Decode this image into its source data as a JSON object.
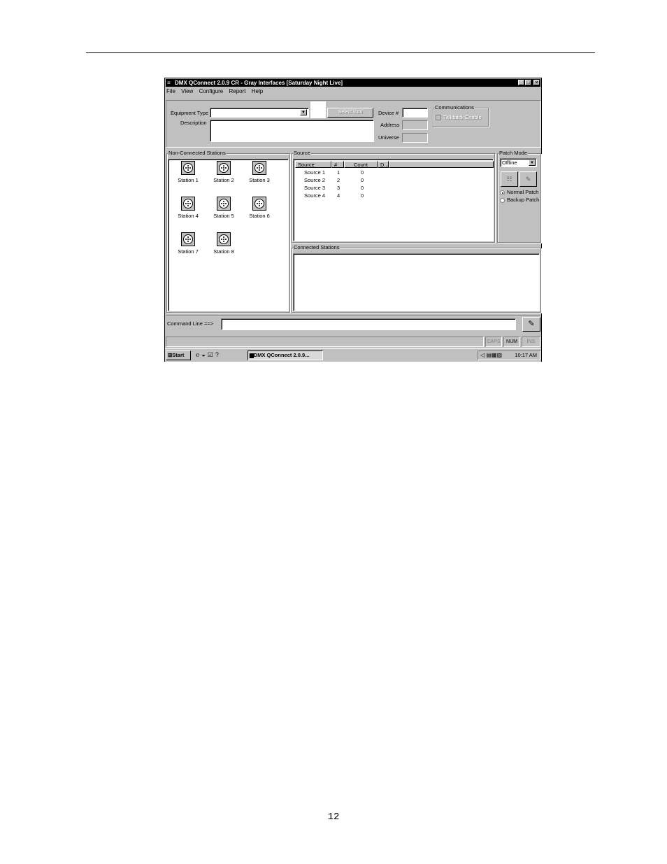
{
  "page": {
    "page_number": "12"
  },
  "window": {
    "title": "DMX QConnect 2.0.9 CR - Gray Interfaces [Saturday Night Live]",
    "controls": {
      "minimize": "_",
      "maximize": "□",
      "close": "×"
    }
  },
  "menu": [
    "File",
    "View",
    "Configure",
    "Report",
    "Help"
  ],
  "equipment": {
    "type_label": "Equipment Type",
    "type_value": "",
    "description_label": "Description",
    "description_value": "",
    "select_icon_label": "Select Icon",
    "device_label": "Device #",
    "device_value": "",
    "address_label": "Address",
    "universe_label": "Universe"
  },
  "communications": {
    "label": "Communications",
    "talkback_label": "Talkback Enable",
    "talkback_checked": false
  },
  "non_connected": {
    "label": "Non-Connected Stations",
    "stations": [
      "Station 1",
      "Station 2",
      "Station 3",
      "Station 4",
      "Station 5",
      "Station 6",
      "Station 7",
      "Station 8"
    ]
  },
  "source": {
    "label": "Source",
    "columns": [
      "Source",
      "#",
      "Count",
      "D..."
    ],
    "rows": [
      {
        "source": "Source 1",
        "num": "1",
        "count": "0"
      },
      {
        "source": "Source 2",
        "num": "2",
        "count": "0"
      },
      {
        "source": "Source 3",
        "num": "3",
        "count": "0"
      },
      {
        "source": "Source 4",
        "num": "4",
        "count": "0"
      }
    ]
  },
  "patch_mode": {
    "label": "Patch Mode",
    "selected": "Offline",
    "options": [
      "Normal Patch",
      "Backup Patch"
    ],
    "selected_option": "Normal Patch"
  },
  "connected": {
    "label": "Connected Stations"
  },
  "command_line": {
    "label": "Command Line ==>",
    "value": ""
  },
  "status": {
    "caps": "CAPS",
    "num": "NUM",
    "ins": "INS"
  },
  "taskbar": {
    "start": "Start",
    "task": "DMX QConnect 2.0.9...",
    "clock": "10:17 AM"
  }
}
